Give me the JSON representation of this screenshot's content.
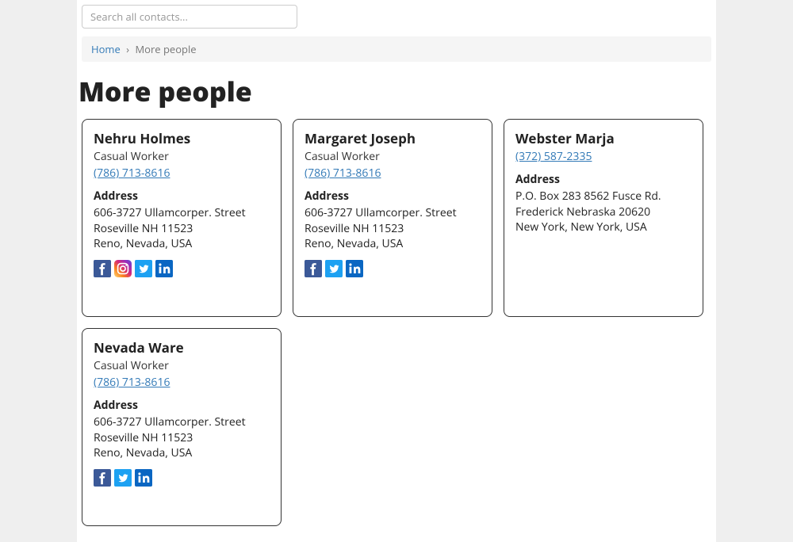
{
  "search": {
    "placeholder": "Search all contacts..."
  },
  "breadcrumb": {
    "home": "Home",
    "current": "More people"
  },
  "page_title": "More people",
  "labels": {
    "address": "Address"
  },
  "people": [
    {
      "name": "Nehru Holmes",
      "role": "Casual Worker",
      "phone": "(786) 713-8616",
      "address_lines": [
        "606-3727 Ullamcorper. Street",
        "Roseville NH 11523",
        "Reno, Nevada, USA"
      ],
      "socials": [
        "facebook",
        "instagram",
        "twitter",
        "linkedin"
      ]
    },
    {
      "name": "Margaret Joseph",
      "role": "Casual Worker",
      "phone": "(786) 713-8616",
      "address_lines": [
        "606-3727 Ullamcorper. Street",
        "Roseville NH 11523",
        "Reno, Nevada, USA"
      ],
      "socials": [
        "facebook",
        "twitter",
        "linkedin"
      ]
    },
    {
      "name": "Webster Marja",
      "role": "",
      "phone": "(372) 587-2335",
      "address_lines": [
        "P.O. Box 283 8562 Fusce Rd.",
        "Frederick Nebraska 20620",
        "New York, New York, USA"
      ],
      "socials": []
    },
    {
      "name": "Nevada Ware",
      "role": "Casual Worker",
      "phone": "(786) 713-8616",
      "address_lines": [
        "606-3727 Ullamcorper. Street",
        "Roseville NH 11523",
        "Reno, Nevada, USA"
      ],
      "socials": [
        "facebook",
        "twitter",
        "linkedin"
      ]
    }
  ]
}
